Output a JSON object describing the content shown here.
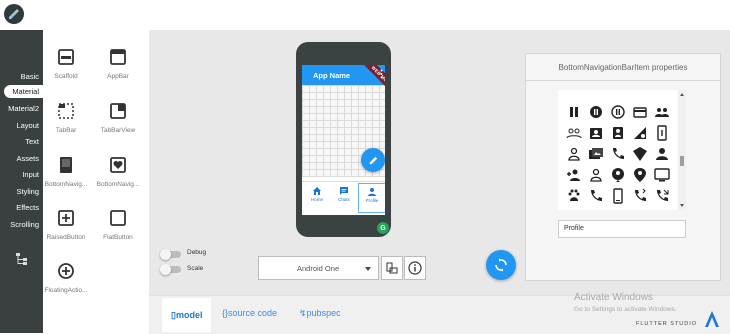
{
  "categories": [
    {
      "label": "Basic",
      "active": false
    },
    {
      "label": "Material",
      "active": true
    },
    {
      "label": "Material2",
      "active": false
    },
    {
      "label": "Layout",
      "active": false
    },
    {
      "label": "Text",
      "active": false
    },
    {
      "label": "Assets",
      "active": false
    },
    {
      "label": "Input",
      "active": false
    },
    {
      "label": "Styling",
      "active": false
    },
    {
      "label": "Effects",
      "active": false
    },
    {
      "label": "Scrolling",
      "active": false
    }
  ],
  "palette": [
    {
      "label": "Scaffold",
      "icon": "scaffold-icon"
    },
    {
      "label": "AppBar",
      "icon": "appbar-icon"
    },
    {
      "label": "TabBar",
      "icon": "tabbar-icon"
    },
    {
      "label": "TabBarView",
      "icon": "tabbarview-icon"
    },
    {
      "label": "BottomNavig...",
      "icon": "bottom-navigation-icon"
    },
    {
      "label": "BottomNavig...",
      "icon": "bottom-navigation-item-icon"
    },
    {
      "label": "RaisedButton",
      "icon": "raised-button-icon"
    },
    {
      "label": "FlatButton",
      "icon": "flat-button-icon"
    },
    {
      "label": "FloatingActio...",
      "icon": "floating-action-button-icon"
    }
  ],
  "phone": {
    "app_title": "App Name",
    "banner": "WEB MODE",
    "nav_items": [
      {
        "label": "Home",
        "icon": "home-icon"
      },
      {
        "label": "Chats",
        "icon": "chat-icon"
      },
      {
        "label": "Profile",
        "icon": "person-icon",
        "selected": true
      }
    ],
    "badge": "G"
  },
  "toggles": [
    {
      "label": "Debug"
    },
    {
      "label": "Scale"
    }
  ],
  "device_select": {
    "value": "Android One"
  },
  "properties": {
    "title": "BottomNavigationBarItem properties",
    "icon_names": [
      "pause-icon",
      "pause-circle-filled-icon",
      "pause-circle-outline-icon",
      "payment-icon",
      "people-icon",
      "people-outline-icon",
      "perm-contact-calendar-icon",
      "perm-identity-icon",
      "perm-data-setting-icon",
      "perm-device-information-icon",
      "person-outline-icon",
      "perm-media-icon",
      "perm-phone-msg-icon",
      "perm-scan-wifi-icon",
      "person-icon",
      "person-add-icon",
      "person-outline-icon-2",
      "person-pin-icon",
      "person-pin-circle-icon",
      "personal-video-icon",
      "pets-icon",
      "phone-icon",
      "phone-android-icon",
      "phone-bluetooth-speaker-icon",
      "phone-callback-icon"
    ],
    "field_value": "Profile"
  },
  "bottom_tabs": [
    {
      "label": "model",
      "active": true
    },
    {
      "label": "source code",
      "active": false
    },
    {
      "label": "pubspec",
      "active": false
    }
  ],
  "watermark": {
    "line1": "Activate Windows",
    "line2": "Go to Settings to activate Windows."
  },
  "brand": "FLUTTER STUDIO"
}
